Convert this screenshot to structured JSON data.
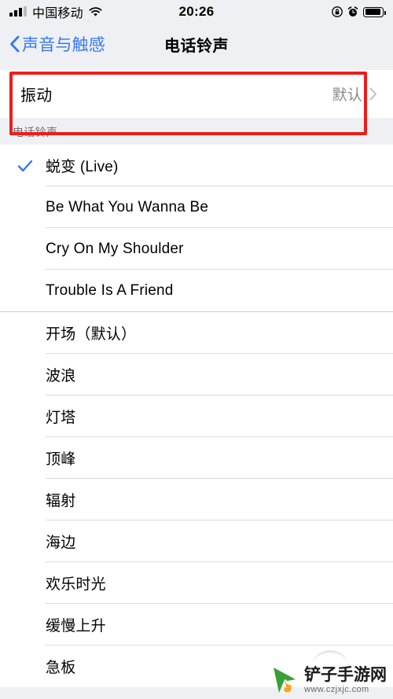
{
  "status_bar": {
    "carrier": "中国移动",
    "time": "20:26",
    "signal_icon": "cellular-signal-icon",
    "wifi_icon": "wifi-icon",
    "rotation_lock_icon": "rotation-lock-icon",
    "alarm_icon": "alarm-clock-icon",
    "battery_icon": "battery-icon"
  },
  "nav": {
    "back_label": "声音与触感",
    "back_icon": "chevron-left-icon",
    "title": "电话铃声"
  },
  "vibration": {
    "label": "振动",
    "value": "默认",
    "disclosure_icon": "chevron-right-icon"
  },
  "section": {
    "header": "电话铃声"
  },
  "custom_tones": [
    {
      "label": "蜕变 (Live)",
      "selected": true
    },
    {
      "label": "Be What You Wanna Be",
      "selected": false
    },
    {
      "label": "Cry On My Shoulder",
      "selected": false
    },
    {
      "label": "Trouble Is A Friend",
      "selected": false
    }
  ],
  "system_tones": [
    {
      "label": "开场（默认）",
      "selected": false
    },
    {
      "label": "波浪",
      "selected": false
    },
    {
      "label": "灯塔",
      "selected": false
    },
    {
      "label": "顶峰",
      "selected": false
    },
    {
      "label": "辐射",
      "selected": false
    },
    {
      "label": "海边",
      "selected": false
    },
    {
      "label": "欢乐时光",
      "selected": false
    },
    {
      "label": "缓慢上升",
      "selected": false
    },
    {
      "label": "急板",
      "selected": false
    }
  ],
  "watermark": {
    "title": "铲子手游网",
    "url": "www.czjxjc.com",
    "logo_icon": "cursor-play-logo-icon"
  },
  "colors": {
    "accent_blue": "#3478f6",
    "annotation_red": "#ee1c18",
    "page_background": "#eff0f4",
    "row_background": "#ffffff",
    "secondary_text": "#8a8a8e"
  }
}
